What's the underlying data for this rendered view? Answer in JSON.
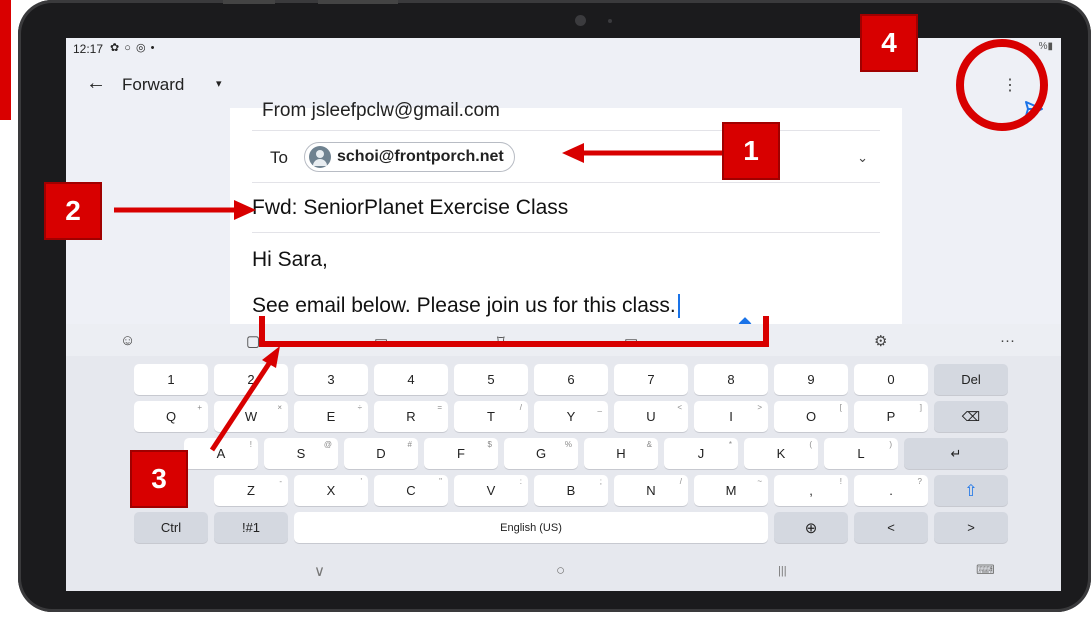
{
  "status_bar": {
    "time": "12:17",
    "icons": "✿ ○ ◎ •",
    "right": "%▮"
  },
  "app_bar": {
    "back_icon": "←",
    "title": "Forward",
    "dropdown_icon": "▾",
    "icon": "⋮"
  },
  "compose": {
    "from": "From jsleefpclw@gmail.com",
    "to_label": "To",
    "to_email": "schoi@frontporch.net",
    "expand_icon": "⌄",
    "subject": "Fwd: SeniorPlanet Exercise Class",
    "greeting": "Hi Sara,",
    "body": "See email below. Please join us for this class."
  },
  "keyboard": {
    "toolbar": {
      "emoji": "☺",
      "settings": "⚙",
      "more": "···"
    },
    "row1": [
      "1",
      "2",
      "3",
      "4",
      "5",
      "6",
      "7",
      "8",
      "9",
      "0",
      "Del"
    ],
    "row2": [
      "Q",
      "W",
      "E",
      "R",
      "T",
      "Y",
      "U",
      "I",
      "O",
      "P",
      "⌫"
    ],
    "row2_hints": [
      "+",
      "×",
      "÷",
      "=",
      "/",
      "_",
      "<",
      ">",
      "[",
      "]",
      ""
    ],
    "row3": [
      "A",
      "S",
      "D",
      "F",
      "G",
      "H",
      "J",
      "K",
      "L",
      "↵"
    ],
    "row3_hints": [
      "!",
      "@",
      "#",
      "$",
      "%",
      "&",
      "*",
      "(",
      ")",
      ""
    ],
    "row4": [
      "Z",
      "X",
      "C",
      "V",
      "B",
      "N",
      "M",
      ",",
      ".",
      "⇧"
    ],
    "row4_hints": [
      "-",
      "'",
      "\"",
      ":",
      ";",
      "/",
      "~",
      "!",
      "?",
      ""
    ],
    "row5": {
      "ctrl": "Ctrl",
      "symbols": "!#1",
      "space": "English (US)",
      "globe": "⊕",
      "left": "<",
      "right": ">"
    }
  },
  "navbar": {
    "back": "∨",
    "home": "○",
    "recents": "|||",
    "keyboard": "⌨"
  },
  "callouts": [
    "1",
    "2",
    "3",
    "4"
  ],
  "colors": {
    "annotation_red": "#d80000",
    "send_blue": "#1a73e8"
  }
}
